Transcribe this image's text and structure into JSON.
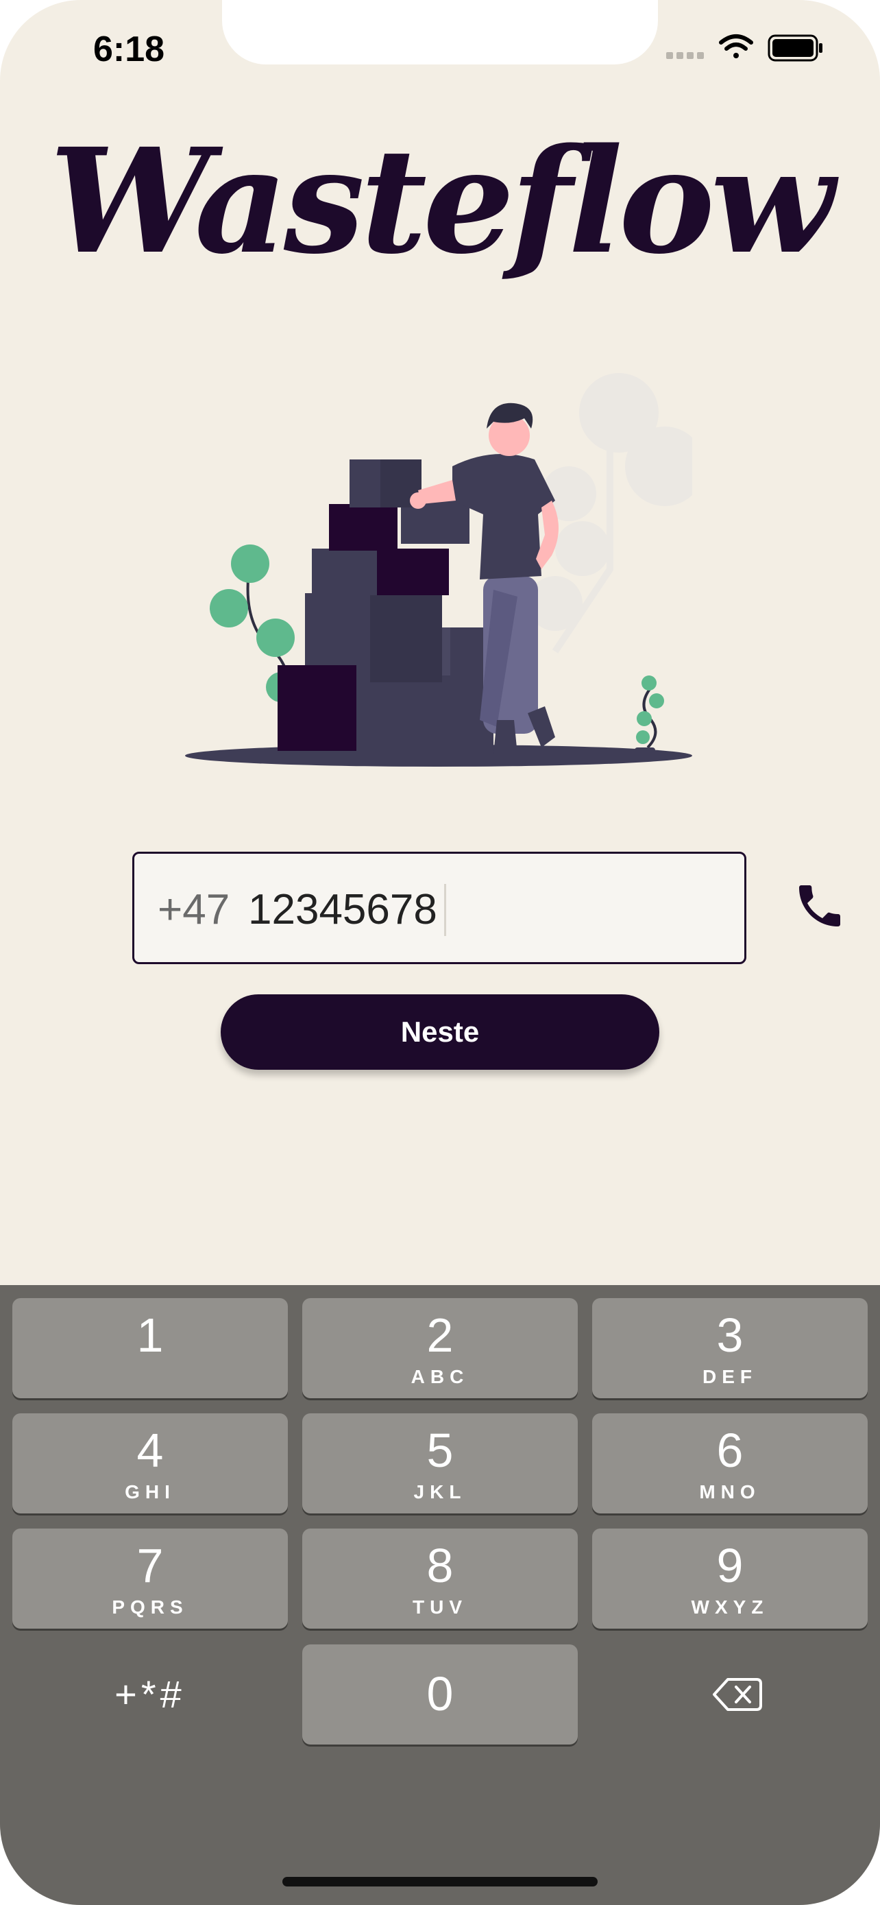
{
  "status_bar": {
    "time": "6:18"
  },
  "app": {
    "logo_text": "Wasteflow"
  },
  "phone_input": {
    "prefix": "+47",
    "value": "12345678"
  },
  "next_button": {
    "label": "Neste"
  },
  "keypad": {
    "keys": [
      {
        "digit": "1",
        "letters": ""
      },
      {
        "digit": "2",
        "letters": "ABC"
      },
      {
        "digit": "3",
        "letters": "DEF"
      },
      {
        "digit": "4",
        "letters": "GHI"
      },
      {
        "digit": "5",
        "letters": "JKL"
      },
      {
        "digit": "6",
        "letters": "MNO"
      },
      {
        "digit": "7",
        "letters": "PQRS"
      },
      {
        "digit": "8",
        "letters": "TUV"
      },
      {
        "digit": "9",
        "letters": "WXYZ"
      },
      {
        "digit": "0",
        "letters": ""
      }
    ],
    "symbols_label": "+*#"
  },
  "colors": {
    "background": "#f3eee4",
    "brand_dark": "#1d0a2b",
    "keyboard_bg": "#686662",
    "key_bg": "#93918d",
    "plant_green": "#5fb98d"
  },
  "icons": {
    "call": "phone-call-icon",
    "delete": "backspace-icon",
    "wifi": "wifi-icon",
    "battery": "battery-icon",
    "signal": "cellular-signal-icon"
  }
}
